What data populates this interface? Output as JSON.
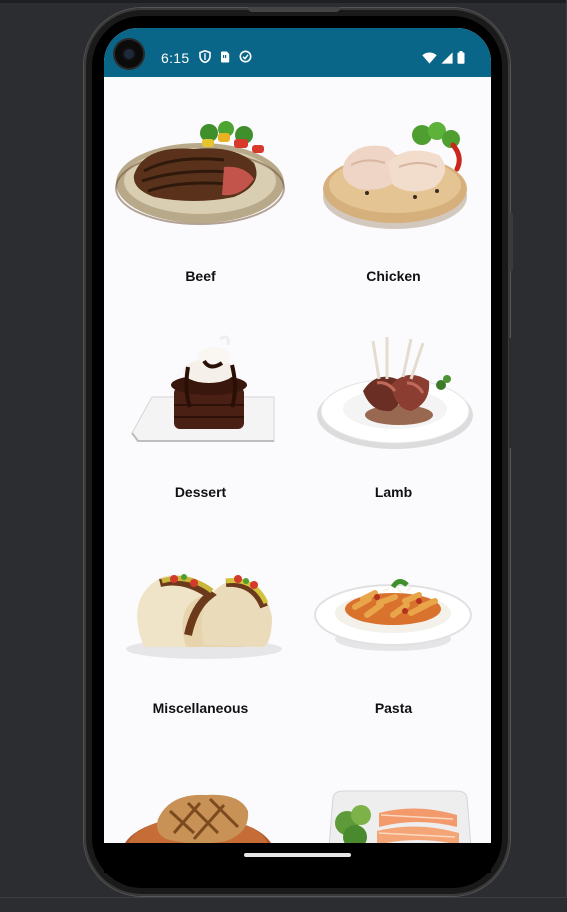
{
  "status_bar": {
    "time": "6:15",
    "background": "#0a6689",
    "left_icons": [
      "shield-icon",
      "sim-card-icon",
      "sync-icon"
    ],
    "right_icons": [
      "wifi-icon",
      "cell-signal-icon",
      "battery-icon"
    ]
  },
  "categories": [
    {
      "label": "Beef",
      "icon": "beef-steak-image"
    },
    {
      "label": "Chicken",
      "icon": "chicken-legs-image"
    },
    {
      "label": "Dessert",
      "icon": "chocolate-cake-image"
    },
    {
      "label": "Lamb",
      "icon": "lamb-chops-image"
    },
    {
      "label": "Miscellaneous",
      "icon": "tacos-image"
    },
    {
      "label": "Pasta",
      "icon": "penne-pasta-image"
    },
    {
      "label": "",
      "icon": "pork-chop-image"
    },
    {
      "label": "",
      "icon": "salmon-plate-image"
    }
  ]
}
